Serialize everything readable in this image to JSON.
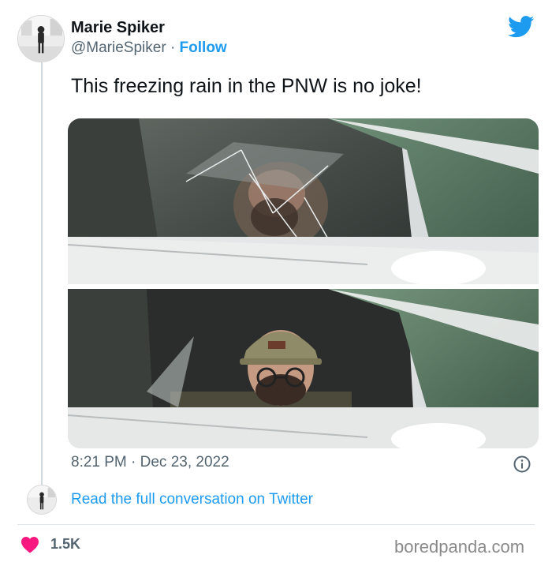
{
  "author": {
    "name": "Marie Spiker",
    "handle": "@MarieSpiker",
    "separator": "·",
    "follow_label": "Follow"
  },
  "tweet": {
    "text": "This freezing rain in the PNW is no joke!",
    "timestamp": "8:21 PM · Dec 23, 2022"
  },
  "media": {
    "photos": [
      "photo-ice-window-before",
      "photo-ice-window-broken"
    ]
  },
  "conversation": {
    "link_label": "Read the full conversation on Twitter"
  },
  "stats": {
    "likes": "1.5K"
  },
  "icons": {
    "brand": "twitter-bird-icon",
    "info": "info-icon",
    "like": "heart-icon"
  },
  "colors": {
    "accent": "#1d9bf0",
    "like": "#f91880",
    "muted": "#536471"
  },
  "watermark": "boredpanda.com"
}
